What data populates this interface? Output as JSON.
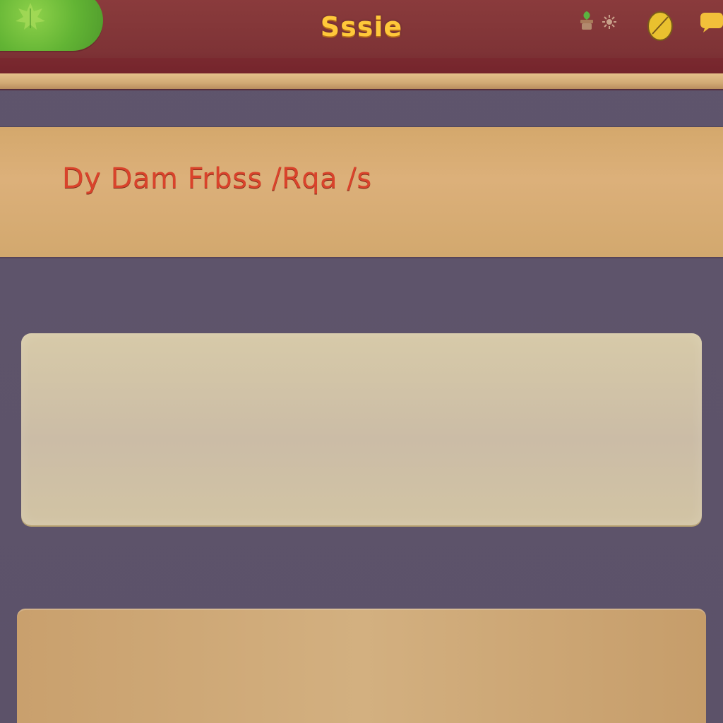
{
  "header": {
    "title": "Sssie",
    "icons": [
      "leaf-icon",
      "plant-icon",
      "sun-icon",
      "leaf-coin-icon",
      "speech-bubble-icon"
    ]
  },
  "banner": {
    "text": "Dy Dam Frbss /Rqa /s"
  },
  "panels": [
    {
      "name": "content-panel-light",
      "text": ""
    },
    {
      "name": "content-panel-tan",
      "text": ""
    }
  ],
  "colors": {
    "header": "#7e3336",
    "header_trim": "#d2aa75",
    "background": "#5e546b",
    "banner": "#d7ad74",
    "banner_text": "#d9432b",
    "title": "#ffc83a",
    "logo": "#62b434",
    "panel_light": "#cfc1a6",
    "panel_tan": "#cda574"
  }
}
